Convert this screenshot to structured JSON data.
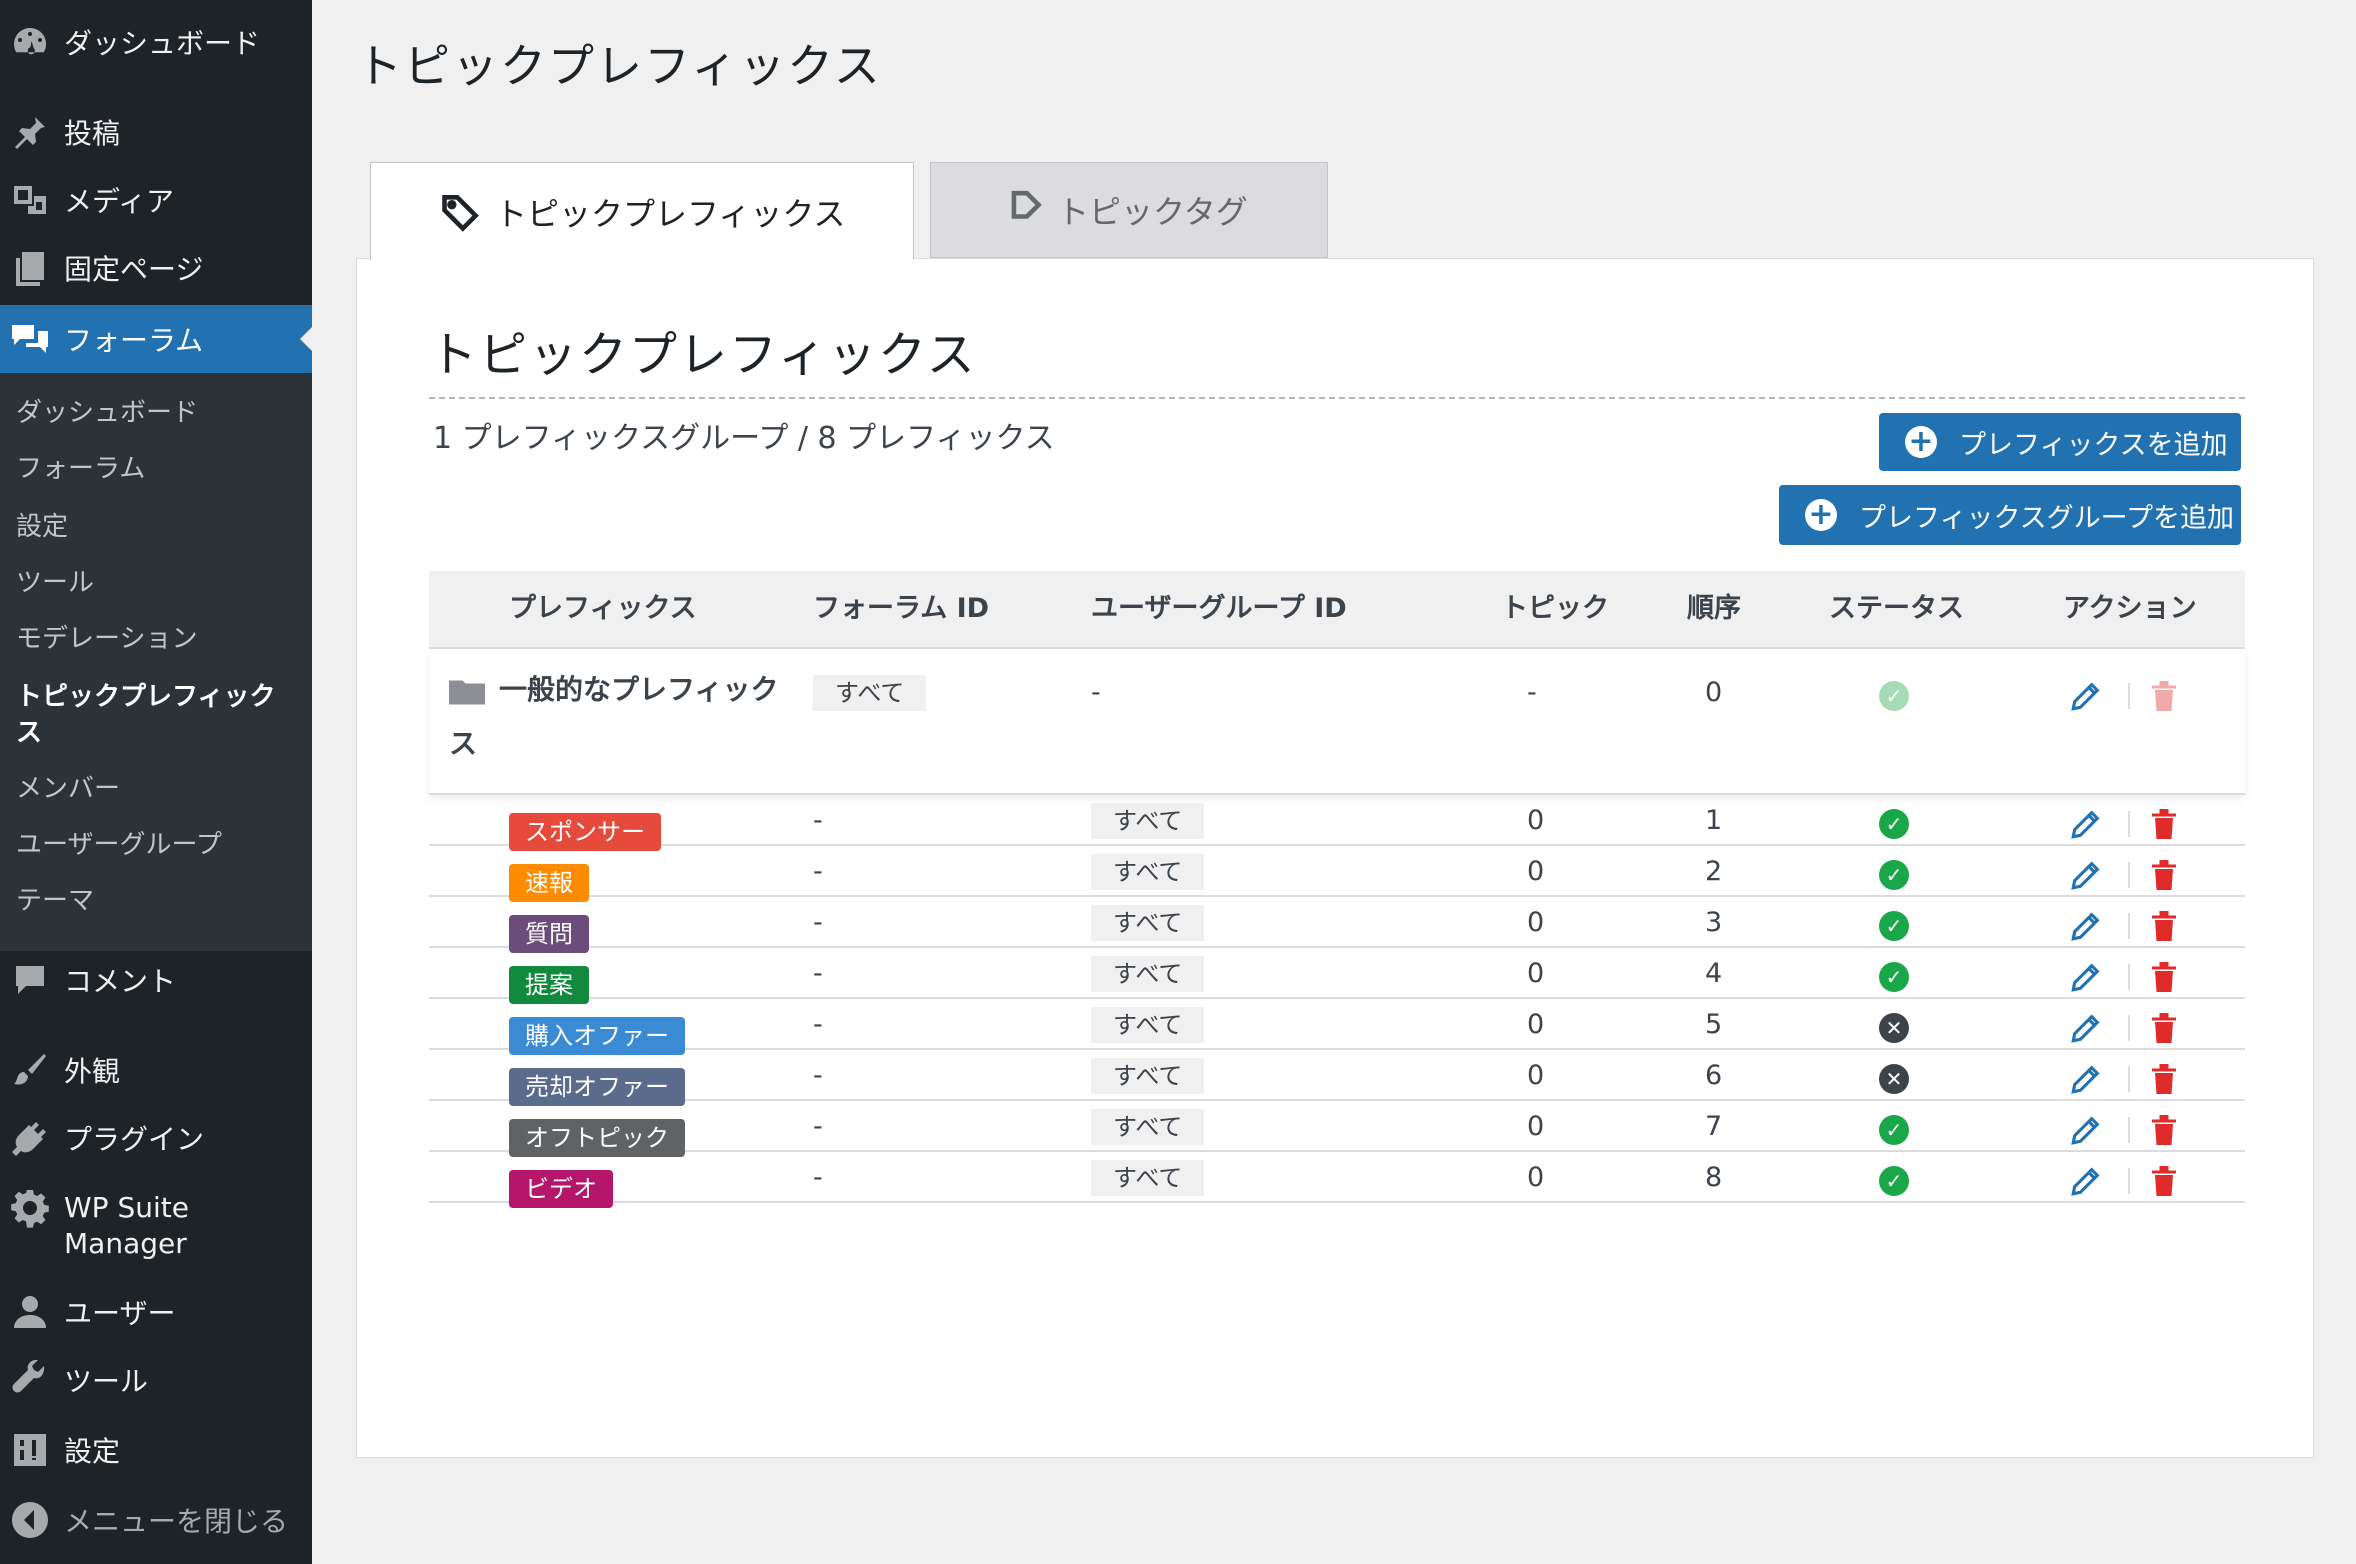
{
  "sidebar": {
    "menu": [
      {
        "label": "ダッシュボード",
        "icon": "dashboard-icon"
      },
      {
        "label": "投稿",
        "icon": "pin-icon"
      },
      {
        "label": "メディア",
        "icon": "media-icon"
      },
      {
        "label": "固定ページ",
        "icon": "pages-icon"
      },
      {
        "label": "フォーラム",
        "icon": "forum-bubbles-icon"
      },
      {
        "label": "コメント",
        "icon": "comment-icon"
      },
      {
        "label": "外観",
        "icon": "paintbrush-icon"
      },
      {
        "label": "プラグイン",
        "icon": "plugin-icon"
      },
      {
        "label": "WP Suite Manager",
        "label_line1": "WP Suite",
        "label_line2": "Manager",
        "icon": "gear-icon"
      },
      {
        "label": "ユーザー",
        "icon": "user-icon"
      },
      {
        "label": "ツール",
        "icon": "wrench-icon"
      },
      {
        "label": "設定",
        "icon": "settings-sliders-icon"
      },
      {
        "label": "メニューを閉じる",
        "icon": "collapse-arrow-icon"
      }
    ],
    "submenu": [
      "ダッシュボード",
      "フォーラム",
      "設定",
      "ツール",
      "モデレーション",
      "トピックプレフィックス",
      "メンバー",
      "ユーザーグループ",
      "テーマ"
    ],
    "colors": {
      "bg": "#1d2327",
      "submenu_bg": "#2c3338",
      "active": "#2271b1"
    }
  },
  "page": {
    "title": "トピックプレフィックス",
    "tabs": [
      {
        "label": "トピックプレフィックス",
        "icon": "tag-outline-icon",
        "active": true
      },
      {
        "label": "トピックタグ",
        "icon": "tag-icon",
        "active": false
      }
    ],
    "panel_title": "トピックプレフィックス",
    "summary": "1 プレフィックスグループ / 8 プレフィックス",
    "buttons": {
      "add_prefix": "プレフィックスを追加",
      "add_group": "プレフィックスグループを追加"
    }
  },
  "table": {
    "headers": [
      "プレフィックス",
      "フォーラム ID",
      "ユーザーグループ ID",
      "トピック",
      "順序",
      "ステータス",
      "アクション"
    ],
    "group": {
      "name": "一般的なプレフィックス",
      "forum": "すべて",
      "usergroup": "-",
      "topics": "-",
      "order": "0",
      "status": "enabled"
    },
    "rows": [
      {
        "prefix": "スポンサー",
        "color": "#e64a3b",
        "forum": "-",
        "usergroup": "すべて",
        "topics": "0",
        "order": "1",
        "status": "enabled"
      },
      {
        "prefix": "速報",
        "color": "#ff8c00",
        "forum": "-",
        "usergroup": "すべて",
        "topics": "0",
        "order": "2",
        "status": "enabled"
      },
      {
        "prefix": "質問",
        "color": "#6b4c7a",
        "forum": "-",
        "usergroup": "すべて",
        "topics": "0",
        "order": "3",
        "status": "enabled"
      },
      {
        "prefix": "提案",
        "color": "#128a3e",
        "forum": "-",
        "usergroup": "すべて",
        "topics": "0",
        "order": "4",
        "status": "enabled"
      },
      {
        "prefix": "購入オファー",
        "color": "#3a8ad4",
        "forum": "-",
        "usergroup": "すべて",
        "topics": "0",
        "order": "5",
        "status": "disabled"
      },
      {
        "prefix": "売却オファー",
        "color": "#5b6b8c",
        "forum": "-",
        "usergroup": "すべて",
        "topics": "0",
        "order": "6",
        "status": "disabled"
      },
      {
        "prefix": "オフトピック",
        "color": "#5f6366",
        "forum": "-",
        "usergroup": "すべて",
        "topics": "0",
        "order": "7",
        "status": "enabled"
      },
      {
        "prefix": "ビデオ",
        "color": "#b5166b",
        "forum": "-",
        "usergroup": "すべて",
        "topics": "0",
        "order": "8",
        "status": "enabled"
      }
    ],
    "colors": {
      "enabled": "#1aa749",
      "disabled": "#3c434a",
      "edit": "#2271b1",
      "delete": "#e02b2b"
    }
  }
}
